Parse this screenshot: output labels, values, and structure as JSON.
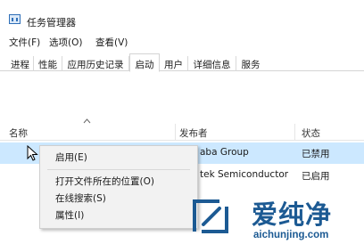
{
  "window": {
    "title": "任务管理器"
  },
  "menu": [
    "文件(F)",
    "选项(O)",
    "查看(V)"
  ],
  "tabs": [
    "进程",
    "性能",
    "应用历史记录",
    "启动",
    "用户",
    "详细信息",
    "服务"
  ],
  "active_tab": "启动",
  "columns": {
    "name": "名称",
    "publisher": "发布者",
    "status": "状态"
  },
  "rows": [
    {
      "publisher": "aba Group",
      "status": "已禁用",
      "selected": true
    },
    {
      "publisher": "tek Semiconductor",
      "status": "已启用",
      "selected": false
    }
  ],
  "context_menu": {
    "items": [
      "启用(E)",
      "打开文件所在的位置(O)",
      "在线搜索(S)",
      "属性(I)"
    ]
  },
  "watermark": {
    "title": "爱纯净",
    "url": "aichunjing.com"
  },
  "colors": {
    "selection": "#cce8ff",
    "watermark": "#1c5a93"
  },
  "icons": {
    "sort": "chevron-up-icon",
    "cursor": "mouse-pointer-icon",
    "app": "task-manager-icon",
    "watermark": "watermark-logo-icon"
  }
}
